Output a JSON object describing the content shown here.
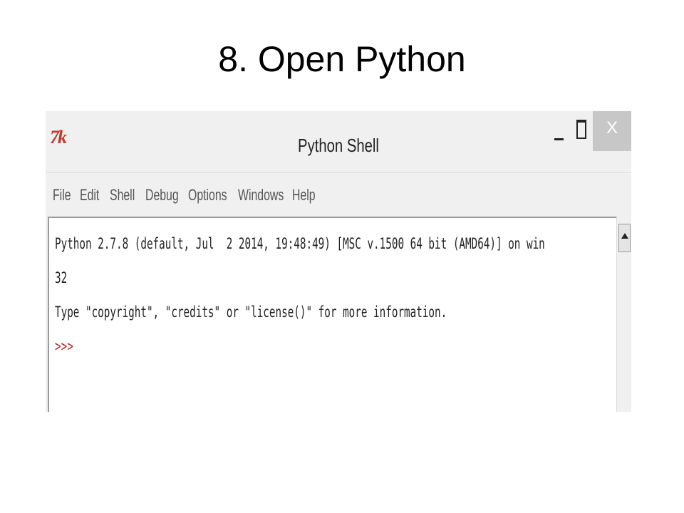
{
  "slide": {
    "title": "8. Open Python"
  },
  "window": {
    "title": "Python Shell",
    "icon": "idle-icon",
    "icon_glyph": "7k",
    "close_label": "X"
  },
  "menu": {
    "items": [
      {
        "label": "File"
      },
      {
        "label": "Edit"
      },
      {
        "label": "Shell"
      },
      {
        "label": "Debug"
      },
      {
        "label": "Options"
      },
      {
        "label": "Windows"
      },
      {
        "label": "Help"
      }
    ]
  },
  "shell": {
    "lines": [
      "Python 2.7.8 (default, Jul  2 2014, 19:48:49) [MSC v.1500 64 bit (AMD64)] on win",
      "32",
      "Type \"copyright\", \"credits\" or \"license()\" for more information."
    ],
    "prompt": ">>>"
  },
  "colors": {
    "prompt": "#b03030",
    "icon": "#c0392b",
    "close_button": "#c7c7c7"
  }
}
